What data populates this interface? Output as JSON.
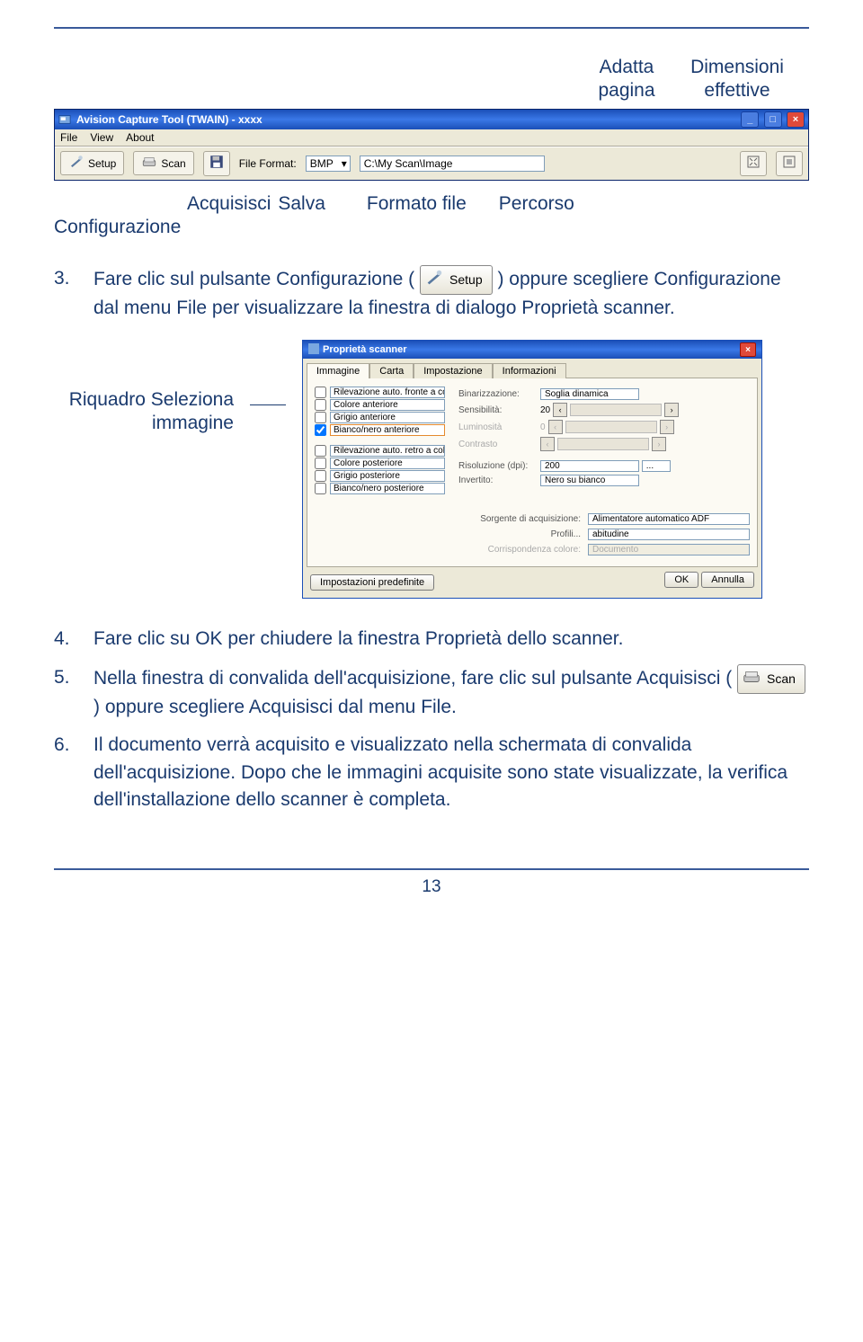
{
  "fit_labels": {
    "adatta": "Adatta pagina",
    "dimensioni": "Dimensioni effettive"
  },
  "toolbar": {
    "title": "Avision Capture Tool (TWAIN) - xxxx",
    "menu": [
      "File",
      "View",
      "About"
    ],
    "setup_label": "Setup",
    "scan_label": "Scan",
    "file_format_label": "File Format:",
    "format_value": "BMP",
    "path_value": "C:\\My Scan\\Image"
  },
  "annot": {
    "configurazione": "Configurazione",
    "acquisisci": "Acquisisci",
    "salva": "Salva",
    "formato": "Formato file",
    "percorso": "Percorso"
  },
  "para3_num": "3.",
  "para3_a": "Fare clic sul pulsante Configurazione (",
  "para3_b": ") oppure scegliere Configurazione dal menu File per visualizzare la finestra di dialogo Proprietà scanner.",
  "setup_btn_label": "Setup",
  "callout": "Riquadro Seleziona immagine",
  "props": {
    "title": "Proprietà scanner",
    "tabs": [
      "Immagine",
      "Carta",
      "Impostazione",
      "Informazioni"
    ],
    "image_options": [
      "Rilevazione auto. fronte a col",
      "Colore anteriore",
      "Grigio anteriore",
      "Bianco/nero anteriore",
      "Rilevazione auto. retro a colo",
      "Colore posteriore",
      "Grigio posteriore",
      "Bianco/nero posteriore"
    ],
    "checked_index": 3,
    "selected_index": 3,
    "binarizzazione_label": "Binarizzazione:",
    "binarizzazione_value": "Soglia dinamica",
    "sensibilita_label": "Sensibilità:",
    "sensibilita_value": "20",
    "luminosita_label": "Luminosità",
    "luminosita_value": "0",
    "contrasto_label": "Contrasto",
    "risoluzione_label": "Risoluzione (dpi):",
    "risoluzione_value": "200",
    "invertito_label": "Invertito:",
    "invertito_value": "Nero su bianco",
    "sorgente_label": "Sorgente di acquisizione:",
    "sorgente_value": "Alimentatore automatico ADF",
    "profili_label": "Profili...",
    "profili_value": "abitudine",
    "corrispondenza_label": "Corrispondenza colore:",
    "corrispondenza_value": "Documento",
    "default_btn": "Impostazioni predefinite",
    "ok_btn": "OK",
    "annulla_btn": "Annulla"
  },
  "para4_num": "4.",
  "para4": "Fare clic su OK per chiudere la finestra Proprietà dello scanner.",
  "para5_num": "5.",
  "para5_a": "Nella finestra di convalida dell'acquisizione, fare clic sul pulsante Acquisisci (",
  "para5_b": ") oppure scegliere Acquisisci dal menu File.",
  "scan_btn_label": "Scan",
  "para6_num": "6.",
  "para6": "Il documento verrà acquisito e visualizzato nella schermata di convalida dell'acquisizione. Dopo che le immagini acquisite sono state visualizzate, la verifica dell'installazione dello scanner è completa.",
  "page_number": "13"
}
